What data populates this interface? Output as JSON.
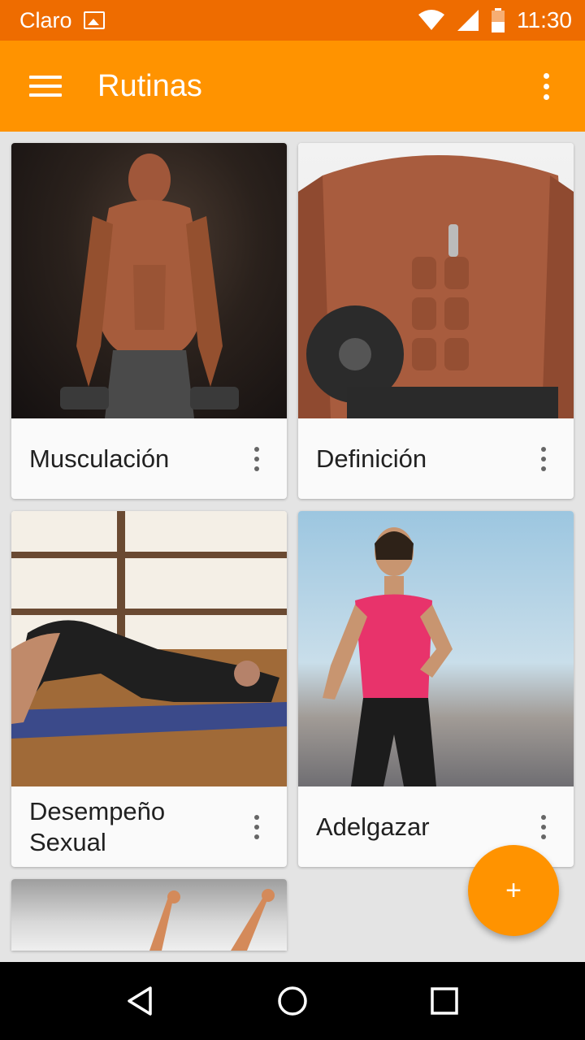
{
  "status_bar": {
    "carrier": "Claro",
    "time": "11:30"
  },
  "app_bar": {
    "title": "Rutinas"
  },
  "cards": [
    {
      "label": "Musculación",
      "image": "muscular-man-with-dumbbells"
    },
    {
      "label": "Definición",
      "image": "defined-abs-torso"
    },
    {
      "label": "Desempeño\nSexual",
      "image": "man-doing-glute-bridge"
    },
    {
      "label": "Adelgazar",
      "image": "woman-running"
    },
    {
      "label": "",
      "image": "person-arms-raised"
    }
  ],
  "fab": {
    "label": "+"
  },
  "colors": {
    "status_bar": "#ee6c00",
    "app_bar": "#ff9300",
    "fab": "#ff9300",
    "background": "#e4e4e4"
  }
}
